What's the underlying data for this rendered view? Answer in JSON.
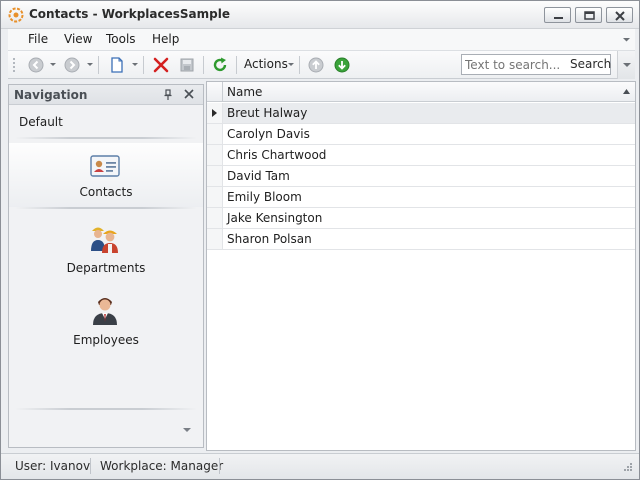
{
  "window": {
    "title": "Contacts - WorkplacesSample"
  },
  "menu": {
    "items": [
      "File",
      "View",
      "Tools",
      "Help"
    ]
  },
  "toolbar": {
    "actions_label": "Actions",
    "search": {
      "placeholder": "Text to search...",
      "button_label": "Search"
    }
  },
  "navigation": {
    "title": "Navigation",
    "group_label": "Default",
    "items": [
      {
        "label": "Contacts",
        "icon": "contacts-card-icon",
        "selected": true
      },
      {
        "label": "Departments",
        "icon": "departments-people-icon",
        "selected": false
      },
      {
        "label": "Employees",
        "icon": "employee-person-icon",
        "selected": false
      }
    ]
  },
  "grid": {
    "columns": [
      "Name"
    ],
    "rows": [
      "Breut Halway",
      "Carolyn Davis",
      "Chris Chartwood",
      "David Tam",
      "Emily Bloom",
      "Jake Kensington",
      "Sharon Polsan"
    ],
    "focused_row": 0
  },
  "status": {
    "user": "User: Ivanov",
    "workplace": "Workplace: Manager"
  },
  "colors": {
    "delete": "#d42020",
    "refresh": "#2f9a2f",
    "go_green": "#3aa33a",
    "accent_orange": "#e8902a"
  }
}
